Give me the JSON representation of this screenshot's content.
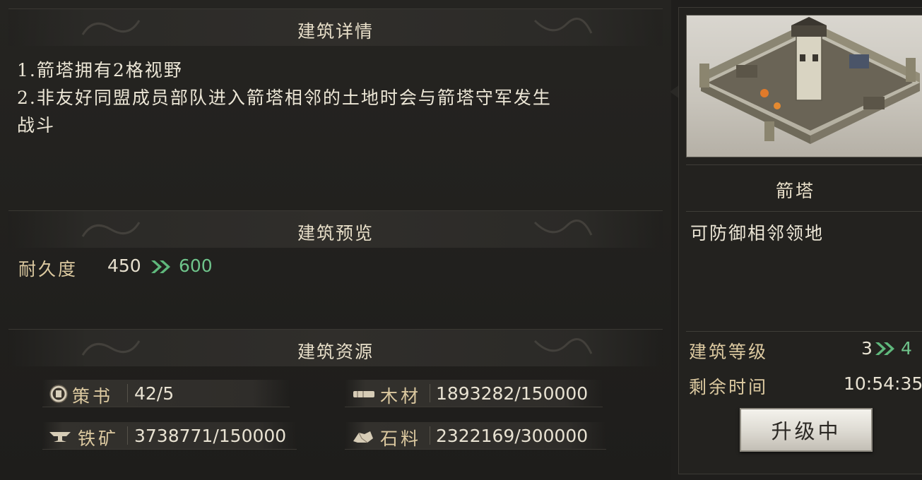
{
  "details": {
    "title": "建筑详情",
    "lines": [
      "1.箭塔拥有2格视野",
      "2.非友好同盟成员部队进入箭塔相邻的土地时会与箭塔守军发生",
      "战斗"
    ]
  },
  "preview": {
    "title": "建筑预览",
    "durability_label": "耐久度",
    "durability_from": "450",
    "durability_to": "600"
  },
  "resources": {
    "title": "建筑资源",
    "items": [
      {
        "icon": "book-icon",
        "label": "策书",
        "value": "42/5"
      },
      {
        "icon": "wood-icon",
        "label": "木材",
        "value": "1893282/150000"
      },
      {
        "icon": "iron-icon",
        "label": "铁矿",
        "value": "3738771/150000"
      },
      {
        "icon": "stone-icon",
        "label": "石料",
        "value": "2322169/300000"
      }
    ]
  },
  "building": {
    "name": "箭塔",
    "description": "可防御相邻领地",
    "level_label": "建筑等级",
    "level_from": "3",
    "level_to": "4",
    "time_label": "剩余时间",
    "time_value": "10:54:35",
    "upgrade_button": "升级中"
  },
  "colors": {
    "accent_green": "#6fc48b",
    "label_gold": "#dcc9a0"
  }
}
